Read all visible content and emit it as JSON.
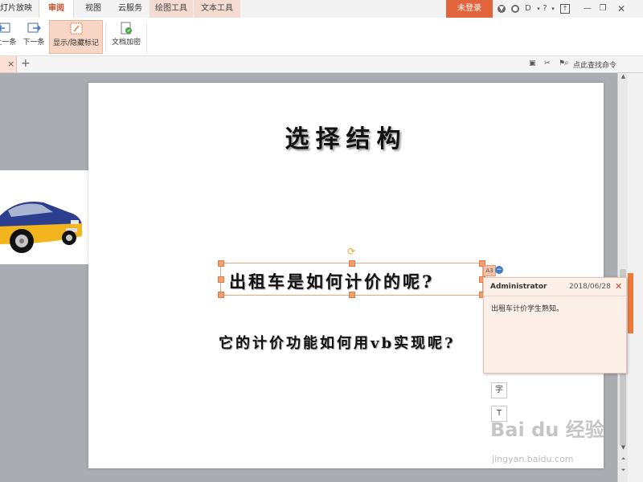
{
  "tabs": {
    "slideshow": "幻灯片放映",
    "review": "审阅",
    "view": "视图",
    "cloud": "云服务",
    "drawing_tools": "绘图工具",
    "text_tools": "文本工具"
  },
  "topbar": {
    "login_label": "未登录"
  },
  "ribbon": {
    "prev_label": "上一条",
    "next_label": "下一条",
    "show_hide_label": "显示/隐藏标记",
    "encrypt_label": "文档加密"
  },
  "docbar": {
    "search_hint": "点此查找命令"
  },
  "slide": {
    "title": "选择结构",
    "line1": "出租车是如何计价的呢?",
    "line2": "它的计价功能如何用vb实现呢?"
  },
  "comment": {
    "marker": "A3",
    "author": "Administrator",
    "date": "2018/06/28",
    "body": "出租车计价学生熟知。"
  },
  "watermark": {
    "main": "Bai du 经验",
    "sub": "jingyan.baidu.com"
  },
  "colors": {
    "accent": "#e2643c",
    "selected_bg": "#f8d6c6",
    "tool_tab_bg": "#f4dcd2",
    "comment_bg": "#fbefe7"
  }
}
